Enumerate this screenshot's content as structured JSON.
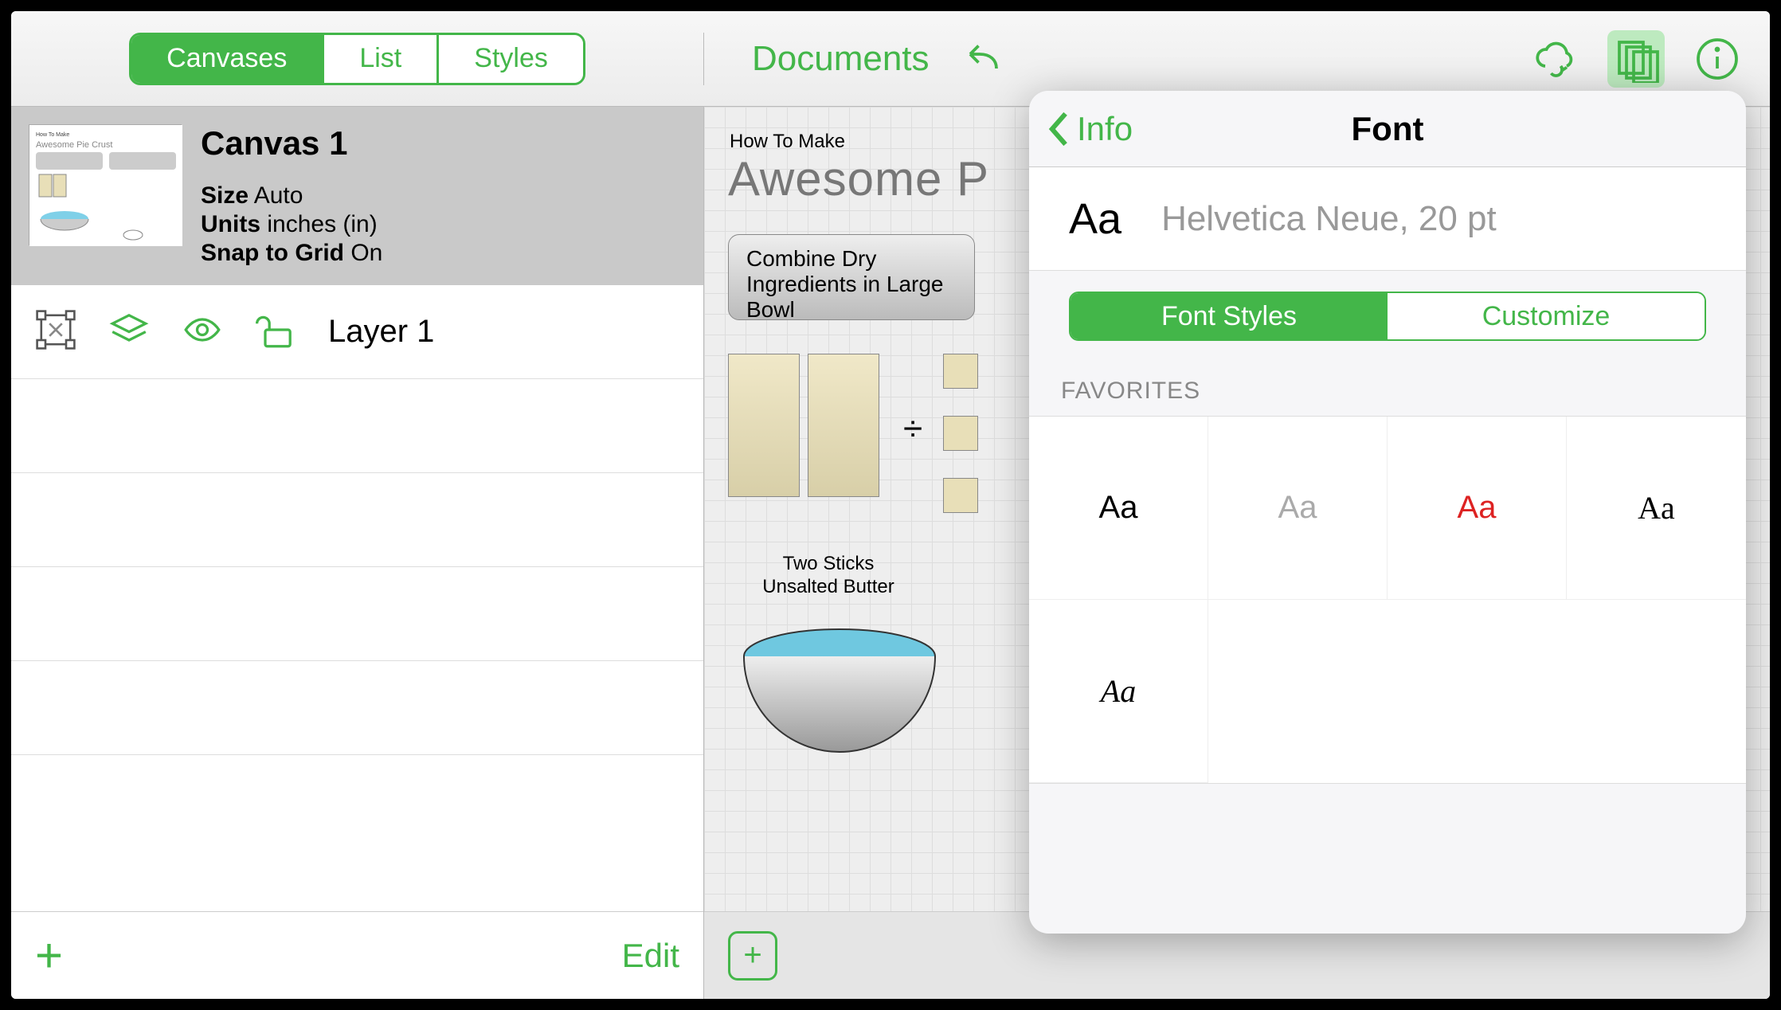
{
  "toolbar": {
    "tabs": {
      "canvases": "Canvases",
      "list": "List",
      "styles": "Styles",
      "active": "canvases"
    },
    "documents_label": "Documents"
  },
  "sidebar": {
    "canvas_title": "Canvas 1",
    "size_key": "Size",
    "size_val": "Auto",
    "units_key": "Units",
    "units_val": "inches (in)",
    "snap_key": "Snap to Grid",
    "snap_val": "On",
    "layer_label": "Layer 1",
    "add_label": "+",
    "edit_label": "Edit"
  },
  "canvas": {
    "small_title": "How To Make",
    "big_title": "Awesome P",
    "combine_text": "Combine Dry Ingredients in Large Bowl",
    "butter_label1": "Two Sticks",
    "butter_label2": "Unsalted Butter",
    "divide_symbol": "÷"
  },
  "popover": {
    "back_label": "Info",
    "title": "Font",
    "preview_aa": "Aa",
    "font_descr": "Helvetica Neue, 20 pt",
    "seg_styles": "Font Styles",
    "seg_customize": "Customize",
    "seg_active": "styles",
    "favorites_label": "FAVORITES",
    "favorites": [
      {
        "text": "Aa",
        "style": "font-family:Helvetica,Arial,sans-serif;color:#000;"
      },
      {
        "text": "Aa",
        "style": "font-family:Helvetica,Arial,sans-serif;color:#aaa;"
      },
      {
        "text": "Aa",
        "style": "font-family:Helvetica,Arial,sans-serif;color:#d22;"
      },
      {
        "text": "Aa",
        "style": "font-family:Georgia,serif;color:#000;"
      },
      {
        "text": "Aa",
        "style": "font-family:'Brush Script MT',cursive;font-style:italic;color:#000;"
      }
    ]
  }
}
